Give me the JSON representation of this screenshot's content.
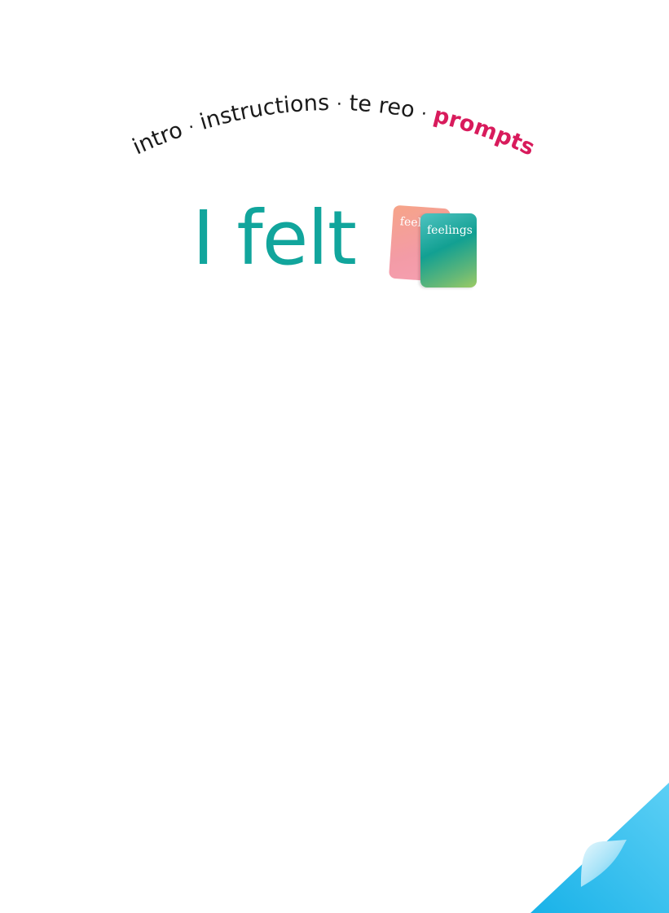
{
  "nav": {
    "items": [
      {
        "label": "intro",
        "active": false
      },
      {
        "label": "instructions",
        "active": false
      },
      {
        "label": "te reo",
        "active": false
      },
      {
        "label": "prompts",
        "active": true
      }
    ],
    "separator": "·",
    "colors": {
      "inactive": "#1a1a1a",
      "active": "#d81b5c"
    }
  },
  "heading": {
    "text": "I felt",
    "color": "#11a59c"
  },
  "cards": {
    "back_label": "feel",
    "front_label": "feelings"
  },
  "corner": {
    "color": "#29b5ea",
    "icon": "page-turn-corner"
  }
}
